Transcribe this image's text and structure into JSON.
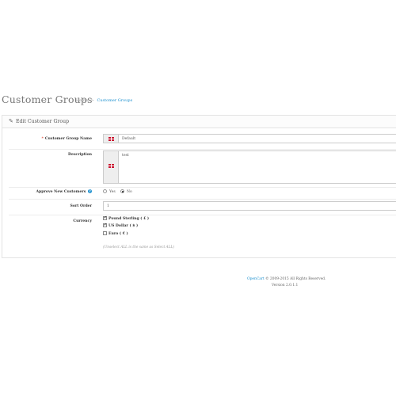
{
  "page": {
    "title": "Customer Groups",
    "breadcrumb": [
      "Home",
      "Customer Groups"
    ],
    "breadcrumb_separator": ">"
  },
  "panel": {
    "heading": "Edit Customer Group",
    "heading_icon": "pencil-icon"
  },
  "form": {
    "group_name_label": "Customer Group Name",
    "group_name_value": "Default",
    "description_label": "Description",
    "description_value": "test",
    "approve_label": "Approve New Customers",
    "approve_options": [
      "Yes",
      "No"
    ],
    "approve_selected": "No",
    "sort_order_label": "Sort Order",
    "sort_order_value": "1",
    "currency_label": "Currency",
    "currencies": [
      {
        "label": "Pound Sterling ( £ )",
        "checked": true
      },
      {
        "label": "US Dollar ( $ )",
        "checked": true
      },
      {
        "label": "Euro ( € )",
        "checked": false
      }
    ],
    "currency_hint": "(Unselect ALL is the same as Select ALL)"
  },
  "footer": {
    "brand": "OpenCart",
    "copyright": "© 2009-2015 All Rights Reserved.",
    "version": "Version 2.0.1.1"
  },
  "colors": {
    "accent": "#1e91cf",
    "required": "#e3503e"
  }
}
